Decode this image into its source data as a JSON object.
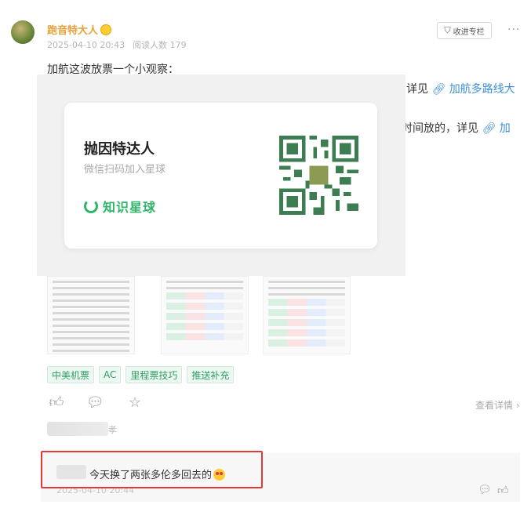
{
  "author": {
    "name": "跑音特大人",
    "date": "2025-04-10 20:43",
    "reads": "阅读人数 179"
  },
  "header": {
    "collect_label": "收进专栏",
    "more_label": "···"
  },
  "post": {
    "line1": "加航这波放票一个小观察：",
    "line2_text": "详见",
    "line2_link": "加航多路线大",
    "line3_text": "时间放的，详见",
    "line3_link": "加"
  },
  "overlay": {
    "title": "抛因特达人",
    "subtitle": "微信扫码加入星球",
    "brand": "知识星球"
  },
  "tags": [
    "中美机票",
    "AC",
    "里程票技巧",
    "推送补充"
  ],
  "actions": {
    "details": "查看详情"
  },
  "commenter": {
    "mark": "孝"
  },
  "comment": {
    "text": "今天换了两张多伦多回去的",
    "time": "2025-04-10 20:44"
  },
  "colors": {
    "accent_green": "#2fb56a",
    "author_orange": "#e6a23c",
    "highlight_red": "#e53935",
    "link_blue": "#3c8ed8"
  }
}
